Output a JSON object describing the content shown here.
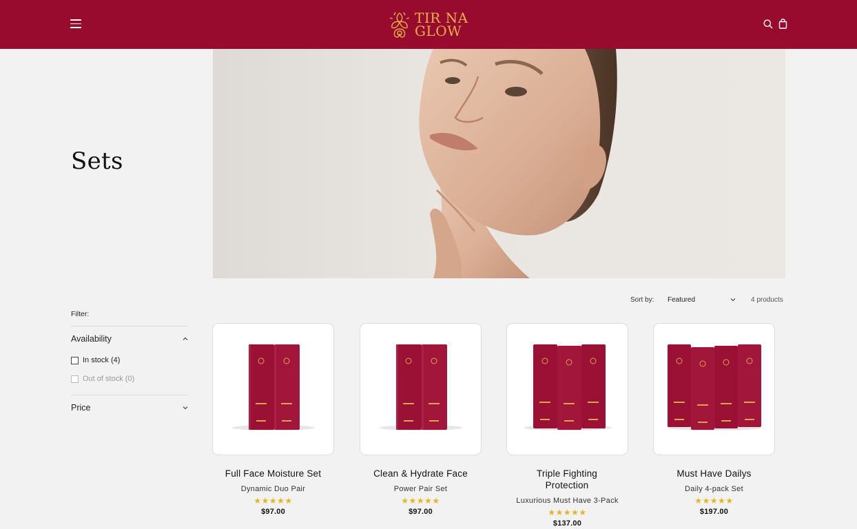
{
  "header": {
    "brand_line1": "TIR NA",
    "brand_line2": "GLOW",
    "brand_color": "#990a2f",
    "accent_color": "#e7b24b",
    "icons": [
      "menu-icon",
      "search-icon",
      "bag-icon"
    ]
  },
  "collection": {
    "title": "Sets"
  },
  "toolbar": {
    "sort_label": "Sort by:",
    "sort_value": "Featured",
    "product_count": "4 products"
  },
  "filters": {
    "label": "Filter:",
    "availability": {
      "title": "Availability",
      "options": [
        {
          "label": "In stock (4)",
          "enabled": true
        },
        {
          "label": "Out of stock (0)",
          "enabled": false
        }
      ]
    },
    "price": {
      "title": "Price"
    }
  },
  "products": [
    {
      "title": "Full Face Moisture Set",
      "subtitle": "Dynamic Duo Pair",
      "stars": "★★★★★",
      "price": "$97.00"
    },
    {
      "title": "Clean & Hydrate Face",
      "subtitle": "Power Pair Set",
      "stars": "★★★★★",
      "price": "$97.00"
    },
    {
      "title": "Triple Fighting Protection",
      "subtitle": "Luxurious Must Have 3-Pack",
      "stars": "★★★★★",
      "price": "$137.00"
    },
    {
      "title": "Must Have Dailys",
      "subtitle": "Daily 4-pack Set",
      "stars": "★★★★★",
      "price": "$197.00"
    }
  ]
}
